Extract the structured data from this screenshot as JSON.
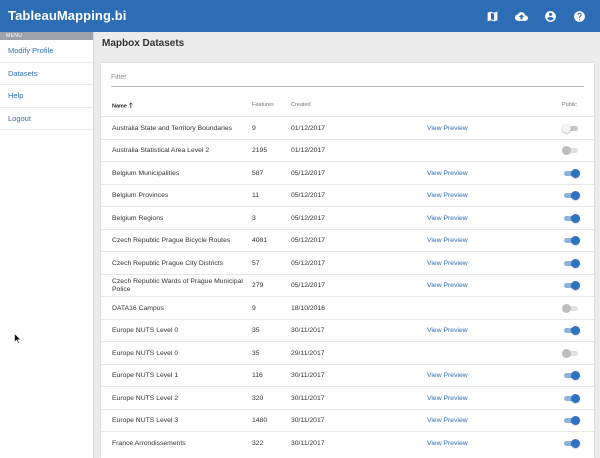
{
  "app": {
    "title": "TableauMapping.bi"
  },
  "topbar": {
    "icons": [
      "map-icon",
      "cloud-upload-icon",
      "account-icon",
      "help-icon"
    ]
  },
  "sidebar": {
    "header": "MENU",
    "items": [
      {
        "label": "Modify Profile"
      },
      {
        "label": "Datasets"
      },
      {
        "label": "Help"
      },
      {
        "label": "Logout"
      }
    ]
  },
  "page": {
    "title": "Mapbox Datasets"
  },
  "filter": {
    "placeholder": "Filter",
    "value": ""
  },
  "table": {
    "columns": {
      "name": "Name",
      "features": "Features",
      "created": "Created",
      "public": "Public"
    },
    "sort": {
      "column": "name",
      "direction": "ascending"
    },
    "rows": [
      {
        "name": "Australia State and Territory Boundaries",
        "features": "9",
        "created": "01/12/2017",
        "preview": "View Preview",
        "public": false,
        "toggle_enabled": true
      },
      {
        "name": "Australia Statistical Area Level 2",
        "features": "2195",
        "created": "01/12/2017",
        "preview": "",
        "public": false,
        "toggle_enabled": false
      },
      {
        "name": "Belgium Municipalities",
        "features": "587",
        "created": "05/12/2017",
        "preview": "View Preview",
        "public": true,
        "toggle_enabled": true
      },
      {
        "name": "Belgium Provinces",
        "features": "11",
        "created": "05/12/2017",
        "preview": "View Preview",
        "public": true,
        "toggle_enabled": true
      },
      {
        "name": "Belgium Regions",
        "features": "3",
        "created": "05/12/2017",
        "preview": "View Preview",
        "public": true,
        "toggle_enabled": true
      },
      {
        "name": "Czech Republic Prague Bicycle Routes",
        "features": "4081",
        "created": "05/12/2017",
        "preview": "View Preview",
        "public": true,
        "toggle_enabled": true
      },
      {
        "name": "Czech Republic Prague City Districts",
        "features": "57",
        "created": "05/12/2017",
        "preview": "View Preview",
        "public": true,
        "toggle_enabled": true
      },
      {
        "name": "Czech Republic Wards of Prague Municipal Police",
        "features": "279",
        "created": "05/12/2017",
        "preview": "View Preview",
        "public": true,
        "toggle_enabled": true
      },
      {
        "name": "DATA16 Campus",
        "features": "9",
        "created": "18/10/2016",
        "preview": "",
        "public": false,
        "toggle_enabled": false
      },
      {
        "name": "Europe NUTS Level 0",
        "features": "35",
        "created": "30/11/2017",
        "preview": "View Preview",
        "public": true,
        "toggle_enabled": true
      },
      {
        "name": "Europe NUTS Level 0",
        "features": "35",
        "created": "29/11/2017",
        "preview": "",
        "public": false,
        "toggle_enabled": false
      },
      {
        "name": "Europe NUTS Level 1",
        "features": "116",
        "created": "30/11/2017",
        "preview": "View Preview",
        "public": true,
        "toggle_enabled": true
      },
      {
        "name": "Europe NUTS Level 2",
        "features": "320",
        "created": "30/11/2017",
        "preview": "View Preview",
        "public": true,
        "toggle_enabled": true
      },
      {
        "name": "Europe NUTS Level 3",
        "features": "1480",
        "created": "30/11/2017",
        "preview": "View Preview",
        "public": true,
        "toggle_enabled": true
      },
      {
        "name": "France Arrondissements",
        "features": "322",
        "created": "30/11/2017",
        "preview": "View Preview",
        "public": true,
        "toggle_enabled": true
      }
    ]
  },
  "colors": {
    "topbar": "#2c6db5",
    "link": "#2d6fb8",
    "toggle_on": "#2f72c4",
    "background": "#ececec"
  }
}
